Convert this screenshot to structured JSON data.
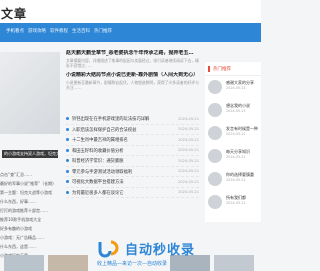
{
  "header": {
    "logo": "文章"
  },
  "nav": {
    "items": [
      "手机看点",
      "游戏攻略",
      "软件教程",
      "生活百科",
      "热门推荐"
    ]
  },
  "left": {
    "banner_caption": "的小游戏支持双人游戏，坦克大",
    "list": [
      "点击“查”汇总……",
      "最好的军事小说“推荐”（长期)",
      "第一主题：坦克大战等小游戏",
      "什么东西，好事……",
      "打打的游戏推荐十部宫……",
      "推荐10款手机游戏大全",
      "好多有趣的小游戏",
      "小游戏：无广告精品……",
      "什么东西，这是……",
      "小游戏打包下载……"
    ]
  },
  "main": {
    "featured": [
      {
        "title": "赵天鹏天鹏全章节_恶老婆执念千年传承之路，抛弃老五…",
        "summary": "文章摘要内容，详细描述了故事的起因与发展经过，吸引读者继续阅读下去，精彩不容错过……"
      },
      {
        "title": "小说精彩大结局节点小说已更新-靠外剧情（人间大到无心）",
        "summary": "小说更新至最新章节，剧情跌宕起伏，人物塑造鲜明，获得了众多读者的好评与关注……"
      }
    ],
    "list": [
      {
        "title": "铃铛出现在在手机游戏里的玩法技巧详解",
        "date": "2024-05-21"
      },
      {
        "title": "入职后该怎样保护自己的合法权益",
        "date": "2024-05-21"
      },
      {
        "title": "十二生肖中最吉祥的属相排名",
        "date": "2024-05-21"
      },
      {
        "title": "和田玉籽料的收藏价值分析",
        "date": "2024-05-21"
      },
      {
        "title": "科普经济学常识：通货膨胀",
        "date": "2024-05-21"
      },
      {
        "title": "零元参与手游测试活动领取福利",
        "date": "2024-05-21"
      },
      {
        "title": "可视化大数据平台搭建方法",
        "date": "2024-05-21"
      },
      {
        "title": "为何最近很多人都在谈论它",
        "date": "2024-05-21"
      }
    ]
  },
  "right": {
    "heading": "热门推荐",
    "items": [
      {
        "title": "感谢大家的分享",
        "sub": "2024-05-21"
      },
      {
        "title": "想念我的小说",
        "sub": "2024-05-21"
      },
      {
        "title": "发言有时候是一种",
        "sub": "2024-05-21"
      },
      {
        "title": "每天分享知识",
        "sub": "2024-05-21"
      },
      {
        "title": "你的选择要慎重",
        "sub": "2024-05-21"
      },
      {
        "title": "所有我们都",
        "sub": "2024-05-21"
      }
    ]
  },
  "watermark": {
    "name": "自动秒收录",
    "slogan": "收上精品—来访一次—自动收录"
  },
  "colors": {
    "nav": "#2d86d6",
    "accent": "#e74c3c"
  }
}
